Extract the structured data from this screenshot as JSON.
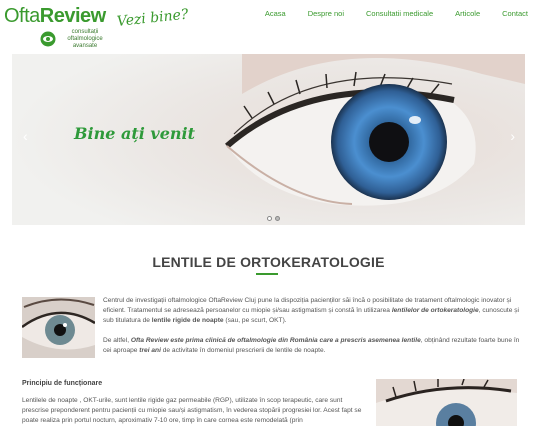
{
  "header": {
    "logo_ofta": "Ofta",
    "logo_review": "Review",
    "logo_sub_1": "consultații",
    "logo_sub_2": "oftalmologice",
    "logo_sub_3": "avansate",
    "tagline": "Vezi bine?"
  },
  "nav": {
    "items": [
      {
        "label": "Acasa"
      },
      {
        "label": "Despre noi"
      },
      {
        "label": "Consultatii medicale"
      },
      {
        "label": "Articole"
      },
      {
        "label": "Contact"
      }
    ]
  },
  "hero": {
    "text": "Bine ați venit",
    "prev_icon": "‹",
    "next_icon": "›",
    "slide_count": 2,
    "active_slide": 1
  },
  "section": {
    "title": "LENTILE DE ORTOKERATOLOGIE"
  },
  "content": {
    "p1_a": "Centrul de investigații oftalmologice OftaReview Cluj pune la dispoziția pacienților săi încă o posibilitate de tratament oftalmologic inovator și eficient. Tratamentul se adresează persoanelor cu miopie și/sau astigmatism și constă în utilizarea ",
    "p1_em": "lentilelor de ortokeratologie",
    "p1_b": ", cunoscute și sub titulatura de ",
    "p1_strong": "lentile rigide de noapte",
    "p1_c": " (sau, pe scurt, OKT).",
    "p2_a": "De altfel, ",
    "p2_strong_em": "Ofta Review este prima clinică de oftalmologie din România care a prescris asemenea lentile",
    "p2_b": ", obținând rezultate foarte bune în cei aproape ",
    "p2_em": "trei ani",
    "p2_c": " de activitate în domeniul prescrierii de lentile de noapte.",
    "subheading": "Principiu de funcționare",
    "p3": "Lentilele de noapte , OKT-urile, sunt lentile rigide gaz permeabile (RGP), utilizate în scop terapeutic, care sunt prescrise preponderent pentru pacienții cu miopie sau/și astigmatism, în vederea stopării progresiei lor. Acest fapt se poate realiza prin portul nocturn, aproximativ 7-10 ore, timp în care cornea este remodelată (prin"
  },
  "colors": {
    "brand_green": "#3a9a2e",
    "iris_blue": "#3d7cc0"
  }
}
